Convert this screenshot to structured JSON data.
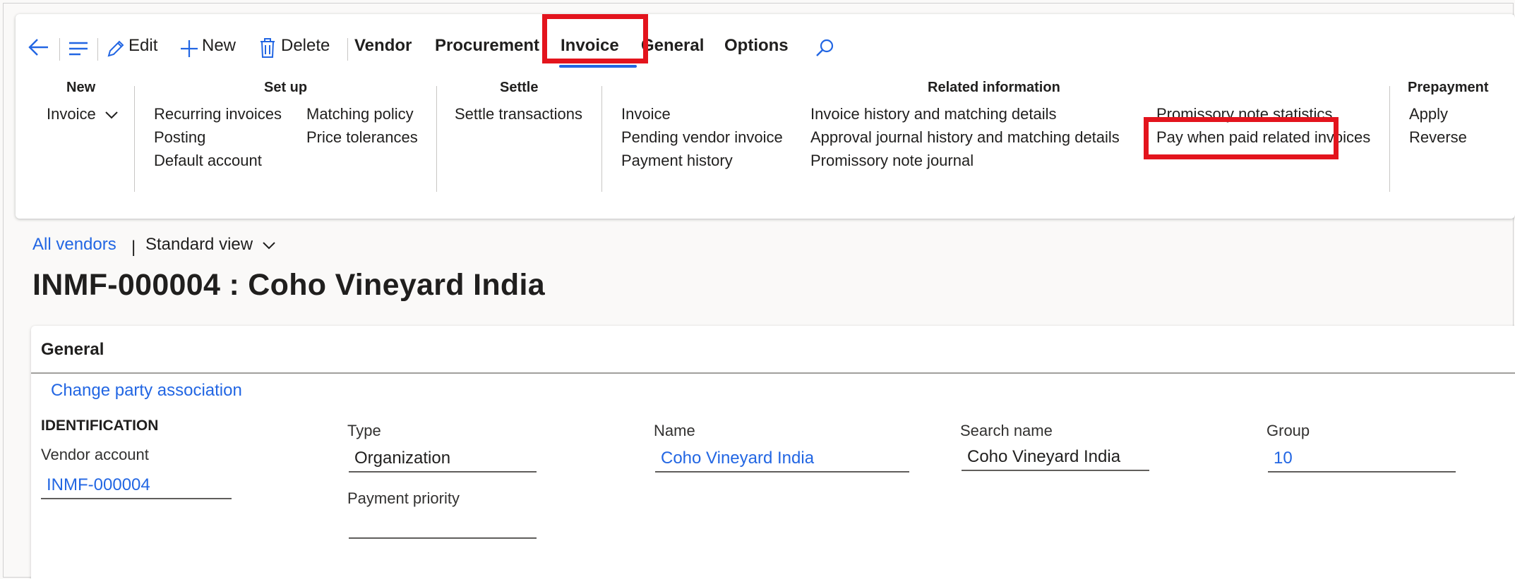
{
  "toolbar": {
    "edit_label": "Edit",
    "new_label": "New",
    "delete_label": "Delete",
    "tabs": [
      "Vendor",
      "Procurement",
      "Invoice",
      "General",
      "Options"
    ],
    "active_tab": "Invoice"
  },
  "ribbon": {
    "groups": {
      "new": {
        "title": "New",
        "items": [
          "Invoice"
        ]
      },
      "setup": {
        "title": "Set up",
        "col1": [
          "Recurring invoices",
          "Posting",
          "Default account"
        ],
        "col2": [
          "Matching policy",
          "Price tolerances"
        ]
      },
      "settle": {
        "title": "Settle",
        "items": [
          "Settle transactions"
        ]
      },
      "related": {
        "title": "Related information",
        "col1": [
          "Invoice",
          "Pending vendor invoice",
          "Payment history"
        ],
        "col2": [
          "Invoice history and matching details",
          "Approval journal history and matching details",
          "Promissory note journal"
        ],
        "col3": [
          "Promissory note statistics",
          "Pay when paid related invoices"
        ]
      },
      "prepayment": {
        "title": "Prepayment",
        "items": [
          "Apply",
          "Reverse"
        ]
      }
    }
  },
  "breadcrumb": {
    "link": "All vendors",
    "separator": "|",
    "view": "Standard view"
  },
  "page_title": "INMF-000004 : Coho Vineyard India",
  "general": {
    "header": "General",
    "link": "Change party association",
    "section_title": "IDENTIFICATION",
    "fields": {
      "vendor_account": {
        "label": "Vendor account",
        "value": "INMF-000004"
      },
      "type": {
        "label": "Type",
        "value": "Organization"
      },
      "payment_priority": {
        "label": "Payment priority",
        "value": ""
      },
      "name": {
        "label": "Name",
        "value": "Coho Vineyard India"
      },
      "search_name": {
        "label": "Search name",
        "value": "Coho Vineyard India"
      },
      "group": {
        "label": "Group",
        "value": "10"
      }
    }
  },
  "colors": {
    "accent": "#2266e3",
    "highlight": "#e3141d"
  }
}
